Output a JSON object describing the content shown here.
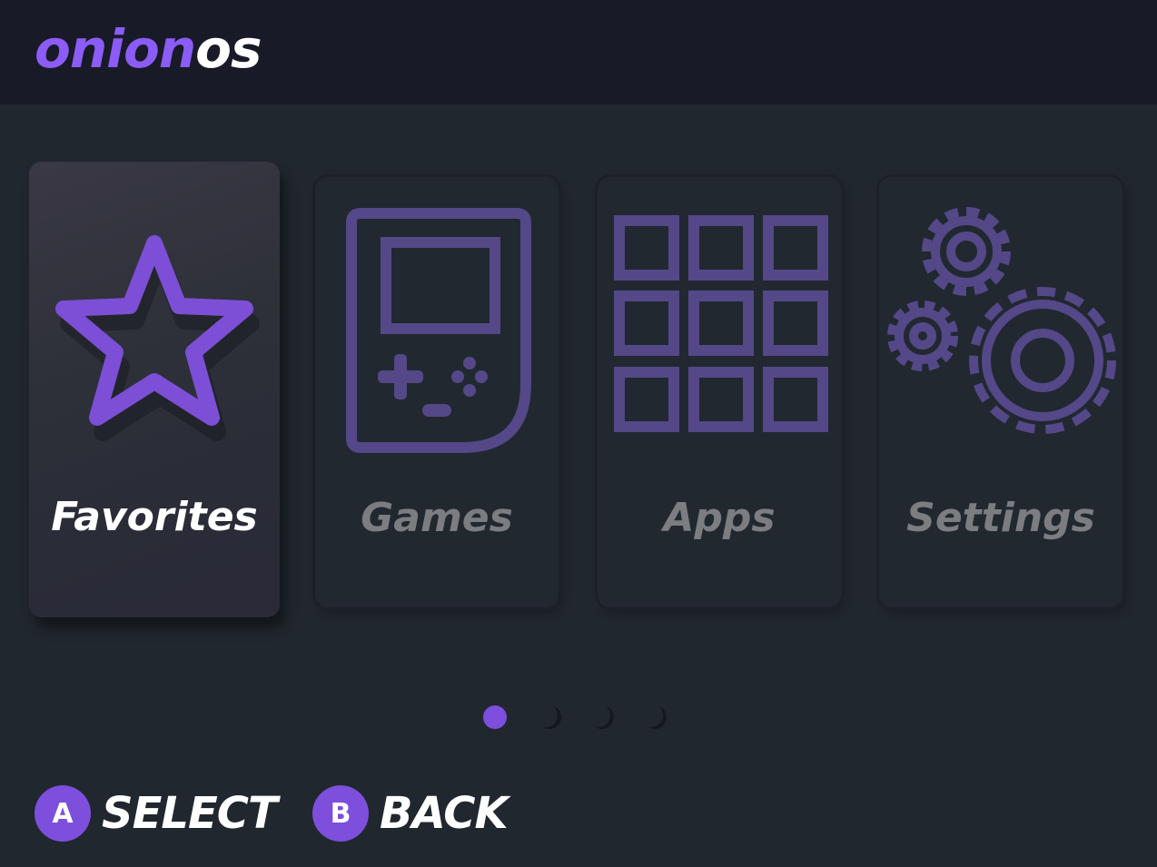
{
  "header": {
    "logo_part1": "onion",
    "logo_part2": "os"
  },
  "menu": {
    "items": [
      {
        "label": "Favorites",
        "icon": "star-icon",
        "selected": true
      },
      {
        "label": "Games",
        "icon": "gameboy-icon",
        "selected": false
      },
      {
        "label": "Apps",
        "icon": "apps-grid-icon",
        "selected": false
      },
      {
        "label": "Settings",
        "icon": "gears-icon",
        "selected": false
      }
    ]
  },
  "pagination": {
    "active_page": 1,
    "page_count": 4
  },
  "footer": {
    "select": {
      "key": "A",
      "label": "SELECT"
    },
    "back": {
      "key": "B",
      "label": "BACK"
    }
  },
  "colors": {
    "accent": "#7d4fdc",
    "icon_inactive": "#544888",
    "background": "#21272e",
    "header": "#191a27"
  }
}
